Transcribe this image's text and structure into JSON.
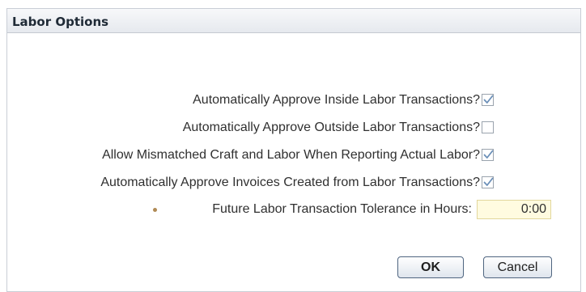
{
  "dialog": {
    "title": "Labor Options"
  },
  "options": [
    {
      "label": "Automatically Approve Inside Labor Transactions?",
      "checked": true
    },
    {
      "label": "Automatically Approve Outside Labor Transactions?",
      "checked": false
    },
    {
      "label": "Allow Mismatched Craft and Labor When Reporting Actual Labor?",
      "checked": true
    },
    {
      "label": "Automatically Approve Invoices Created from Labor Transactions?",
      "checked": true
    }
  ],
  "tolerance": {
    "label": "Future Labor Transaction Tolerance in Hours:",
    "value": "0:00",
    "required_icon": "required-dot-icon"
  },
  "buttons": {
    "ok_label": "OK",
    "cancel_label": "Cancel"
  },
  "colors": {
    "check": "#6b8fb8",
    "required": "#b08a55",
    "input_bg": "#fffbe0"
  }
}
